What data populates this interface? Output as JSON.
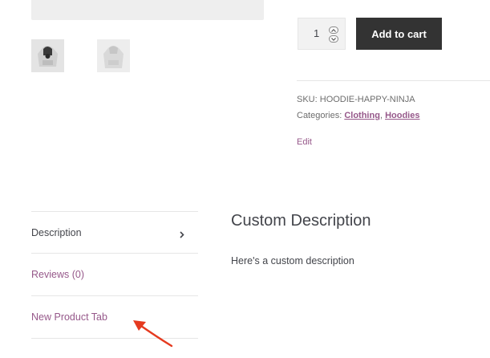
{
  "product": {
    "quantity": "1",
    "add_to_cart_label": "Add to cart",
    "sku_label": "SKU:",
    "sku_value": "HOODIE-HAPPY-NINJA",
    "categories_label": "Categories:",
    "categories": [
      "Clothing",
      "Hoodies"
    ],
    "category_separator": ",",
    "edit_label": "Edit"
  },
  "tabs": [
    {
      "label": "Description",
      "active": true
    },
    {
      "label": "Reviews (0)",
      "active": false
    },
    {
      "label": "New Product Tab",
      "active": false
    }
  ],
  "panel": {
    "heading": "Custom Description",
    "text": "Here's a custom description"
  },
  "icons": {
    "tab_arrow": "chevron-right-icon",
    "annotation": "red-arrow-annotation",
    "qty_up": "chevron-up-icon",
    "qty_down": "chevron-down-icon"
  },
  "colors": {
    "accent": "#96588a",
    "button_bg": "#333333",
    "annotation": "#e53a1f"
  }
}
